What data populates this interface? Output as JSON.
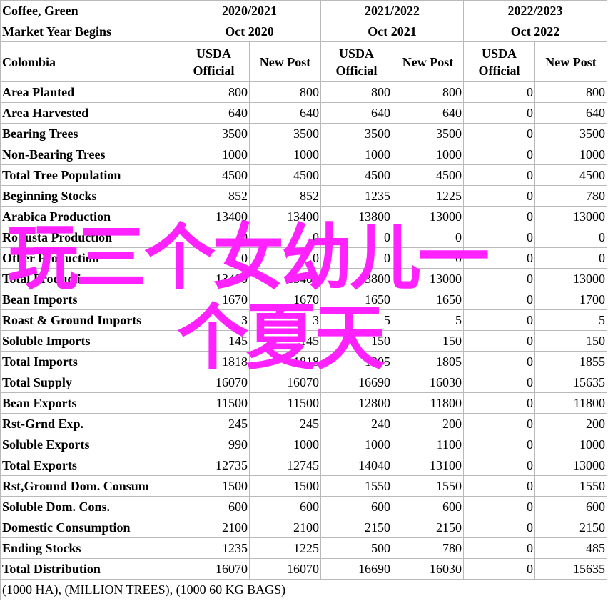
{
  "header": {
    "row1_label": "Coffee, Green",
    "row2_label": "Market Year Begins",
    "row3_label": "Colombia",
    "years": [
      "2020/2021",
      "2021/2022",
      "2022/2023"
    ],
    "begins": [
      "Oct 2020",
      "Oct 2021",
      "Oct 2022"
    ],
    "usda": [
      "USDA",
      "Official"
    ],
    "newpost": "New Post"
  },
  "rows": [
    {
      "label": "Area Planted",
      "values": [
        "800",
        "800",
        "800",
        "800",
        "0",
        "800"
      ]
    },
    {
      "label": "Area Harvested",
      "values": [
        "640",
        "640",
        "640",
        "640",
        "0",
        "640"
      ]
    },
    {
      "label": "Bearing Trees",
      "values": [
        "3500",
        "3500",
        "3500",
        "3500",
        "0",
        "3500"
      ]
    },
    {
      "label": "Non-Bearing Trees",
      "values": [
        "1000",
        "1000",
        "1000",
        "1000",
        "0",
        "1000"
      ]
    },
    {
      "label": "Total Tree Population",
      "values": [
        "4500",
        "4500",
        "4500",
        "4500",
        "0",
        "4500"
      ]
    },
    {
      "label": "Beginning Stocks",
      "values": [
        "852",
        "852",
        "1235",
        "1225",
        "0",
        "780"
      ]
    },
    {
      "label": "Arabica Production",
      "values": [
        "13400",
        "13400",
        "13800",
        "13000",
        "0",
        "13000"
      ]
    },
    {
      "label": "Robusta Production",
      "values": [
        "0",
        "0",
        "0",
        "0",
        "0",
        "0"
      ]
    },
    {
      "label": "Other Production",
      "values": [
        "0",
        "0",
        "0",
        "0",
        "0",
        "0"
      ]
    },
    {
      "label": "Total Production",
      "values": [
        "13400",
        "13400",
        "13800",
        "13000",
        "0",
        "13000"
      ]
    },
    {
      "label": "Bean Imports",
      "values": [
        "1670",
        "1670",
        "1650",
        "1650",
        "0",
        "1700"
      ]
    },
    {
      "label": "Roast & Ground Imports",
      "values": [
        "3",
        "3",
        "5",
        "5",
        "0",
        "5"
      ]
    },
    {
      "label": "Soluble Imports",
      "values": [
        "145",
        "145",
        "150",
        "150",
        "0",
        "150"
      ]
    },
    {
      "label": "Total Imports",
      "values": [
        "1818",
        "1818",
        "1805",
        "1805",
        "0",
        "1855"
      ]
    },
    {
      "label": "Total Supply",
      "values": [
        "16070",
        "16070",
        "16690",
        "16030",
        "0",
        "15635"
      ]
    },
    {
      "label": "Bean Exports",
      "values": [
        "11500",
        "11500",
        "12800",
        "11800",
        "0",
        "11800"
      ]
    },
    {
      "label": "Rst-Grnd Exp.",
      "values": [
        "245",
        "245",
        "240",
        "200",
        "0",
        "200"
      ]
    },
    {
      "label": "Soluble Exports",
      "values": [
        "990",
        "1000",
        "1000",
        "1100",
        "0",
        "1000"
      ]
    },
    {
      "label": "Total Exports",
      "values": [
        "12735",
        "12745",
        "14040",
        "13100",
        "0",
        "13000"
      ]
    },
    {
      "label": "Rst,Ground Dom. Consum",
      "values": [
        "1500",
        "1500",
        "1550",
        "1550",
        "0",
        "1550"
      ]
    },
    {
      "label": "Soluble Dom. Cons.",
      "values": [
        "600",
        "600",
        "600",
        "600",
        "0",
        "600"
      ]
    },
    {
      "label": "Domestic Consumption",
      "values": [
        "2100",
        "2100",
        "2150",
        "2150",
        "0",
        "2150"
      ]
    },
    {
      "label": "Ending Stocks",
      "values": [
        "1235",
        "1225",
        "500",
        "780",
        "0",
        "485"
      ]
    },
    {
      "label": "Total Distribution",
      "values": [
        "16070",
        "16070",
        "16690",
        "16030",
        "0",
        "15635"
      ]
    }
  ],
  "footer": "(1000 HA), (MILLION TREES), (1000 60 KG BAGS)",
  "overlay": {
    "line1": "玩三个女幼儿一",
    "line2": "个夏天",
    "color": "#ff22ff"
  }
}
